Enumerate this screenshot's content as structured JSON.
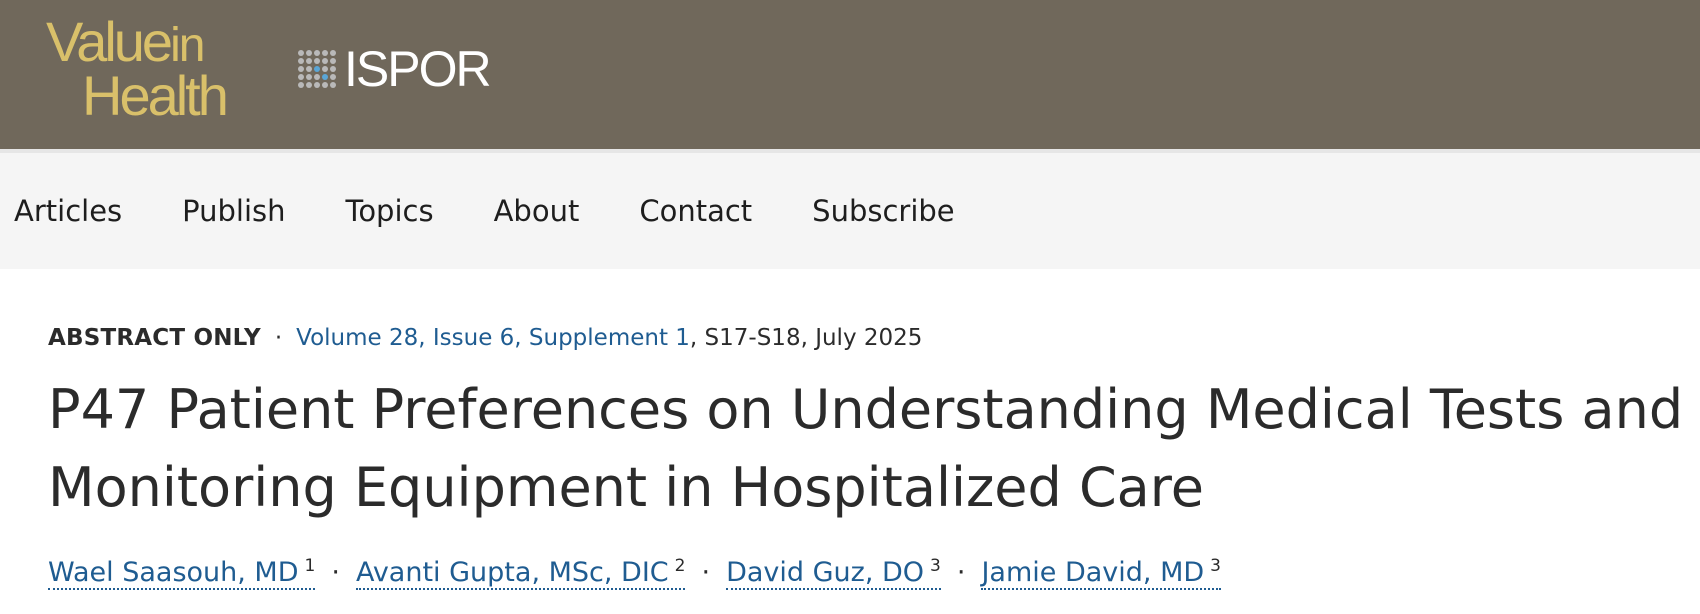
{
  "header": {
    "journal_logo": {
      "line1": "Value",
      "line1_small": "in",
      "line2": "Health",
      "color": "#d9c06a"
    },
    "society_logo": {
      "text": "ISPOR",
      "icon": "dot-grid-icon"
    },
    "background": "#70685b"
  },
  "nav": {
    "items": [
      {
        "label": "Articles"
      },
      {
        "label": "Publish"
      },
      {
        "label": "Topics"
      },
      {
        "label": "About"
      },
      {
        "label": "Contact"
      },
      {
        "label": "Subscribe"
      }
    ]
  },
  "article": {
    "badge": "ABSTRACT ONLY",
    "separator": "·",
    "issue_link": "Volume 28, Issue 6, Supplement 1",
    "pages_date": ", S17-S18, July 2025",
    "title": "P47 Patient Preferences on Understanding Medical Tests and Monitoring Equipment in Hospitalized Care",
    "authors": [
      {
        "name": "Wael Saasouh, MD",
        "aff": "1"
      },
      {
        "name": "Avanti Gupta, MSc, DIC",
        "aff": "2"
      },
      {
        "name": "David Guz, DO",
        "aff": "3"
      },
      {
        "name": "Jamie David, MD",
        "aff": "3"
      }
    ],
    "link_color": "#1f5c91"
  }
}
